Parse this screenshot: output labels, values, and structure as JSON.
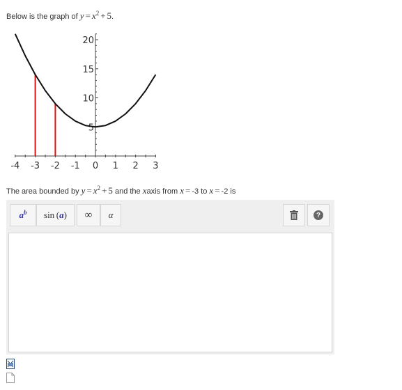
{
  "intro": {
    "prefix": "Below is the graph of",
    "eq_var": "y",
    "eq_base": "x",
    "eq_exp": "2",
    "eq_const": "5"
  },
  "chart_data": {
    "type": "line",
    "title": "",
    "function": "y = x^2 + 5",
    "series": [
      {
        "x": [
          -4,
          -3.5,
          -3,
          -2.5,
          -2,
          -1.5,
          -1,
          -0.5,
          0,
          0.5,
          1,
          1.5,
          2,
          2.5,
          3
        ],
        "y": [
          21,
          17.25,
          14,
          11.25,
          9,
          7.25,
          6,
          5.25,
          5,
          5.25,
          6,
          7.25,
          9,
          11.25,
          14
        ]
      }
    ],
    "vertical_lines": [
      {
        "x": -3,
        "y": 14,
        "color": "#dd1111"
      },
      {
        "x": -2,
        "y": 9,
        "color": "#dd1111"
      }
    ],
    "xlim": [
      -4,
      3
    ],
    "ylim": [
      0,
      21
    ],
    "x_ticks": [
      "-4",
      "-3",
      "-2",
      "-1",
      "0",
      "1",
      "2",
      "3"
    ],
    "y_ticks": [
      "5",
      "10",
      "15",
      "20"
    ],
    "grid": false,
    "colors": {
      "curve": "#111111",
      "bounds": "#dd1111",
      "axis": "#444444"
    }
  },
  "question": {
    "prefix": "The area bounded by",
    "eq_var": "y",
    "eq_base": "x",
    "eq_exp": "2",
    "eq_const": "5",
    "middle": "and the",
    "axis_var": "x",
    "axis_word": "axis from",
    "from_var": "x",
    "from_val": "-3",
    "to_word": "to",
    "to_var": "x",
    "to_val": "-2",
    "suffix": "is"
  },
  "toolbar": {
    "power_base": "a",
    "power_exp": "b",
    "sin_label": "sin",
    "sin_arg": "a",
    "infinity_label": "∞",
    "alpha_label": "α",
    "help_label": "?"
  },
  "icons": {
    "power": "superscript-icon",
    "trash": "trash-icon",
    "help": "help-icon",
    "file1": "image-file-icon",
    "file2": "document-file-icon"
  }
}
